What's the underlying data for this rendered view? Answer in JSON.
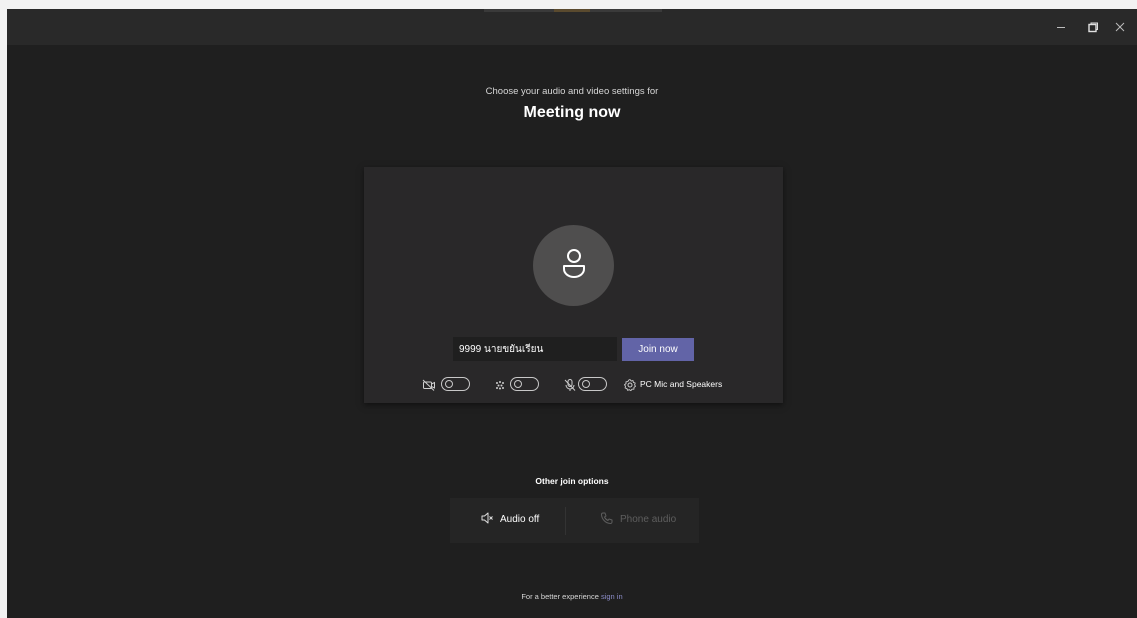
{
  "window": {
    "controls": [
      "minimize-icon",
      "maximize-icon",
      "close-icon"
    ]
  },
  "heading": {
    "subtitle": "Choose your audio and video settings for",
    "title": "Meeting now"
  },
  "preview": {
    "avatar_icon": "person-icon",
    "name_value": "9999 นายขยันเรียน",
    "join_label": "Join now",
    "controls": {
      "camera_icon": "camera-off-icon",
      "camera_on": false,
      "blur_icon": "background-blur-icon",
      "blur_on": false,
      "mic_icon": "mic-off-icon",
      "mic_on": false,
      "device_icon": "gear-icon",
      "device_label": "PC Mic and Speakers"
    }
  },
  "other_options": {
    "title": "Other join options",
    "audio_off_label": "Audio off",
    "phone_audio_label": "Phone audio"
  },
  "footer": {
    "text": "For a better experience",
    "link": "sign in"
  },
  "colors": {
    "accent": "#6264a7",
    "background": "#1f1f1f",
    "card": "#292829",
    "link": "#8b8cc7"
  }
}
